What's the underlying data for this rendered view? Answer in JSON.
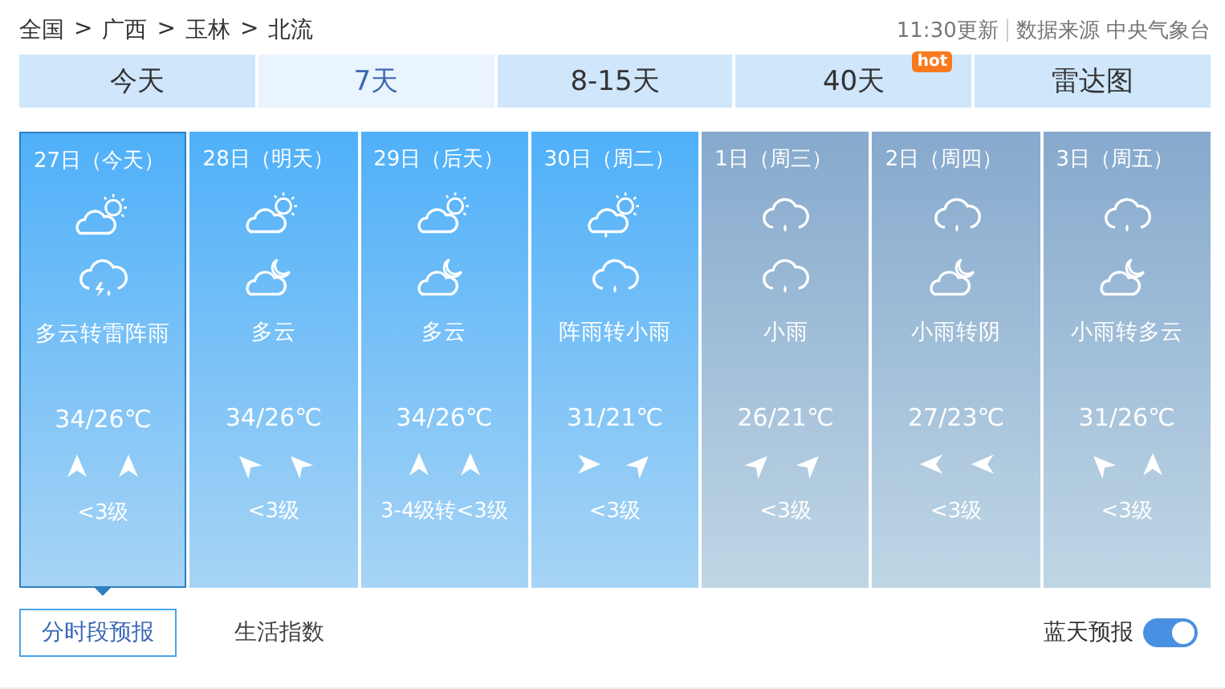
{
  "breadcrumb": [
    "全国",
    "广西",
    "玉林",
    "北流"
  ],
  "breadcrumb_separator": ">",
  "update_time": "11:30更新",
  "source": "数据来源 中央气象台",
  "tabs": [
    {
      "label": "今天",
      "selected": false,
      "hot": false
    },
    {
      "label": "7天",
      "selected": true,
      "hot": false
    },
    {
      "label": "8-15天",
      "selected": false,
      "hot": false
    },
    {
      "label": "40天",
      "selected": false,
      "hot": true
    },
    {
      "label": "雷达图",
      "selected": false,
      "hot": false
    }
  ],
  "hot_badge": "hot",
  "days": [
    {
      "date": "27日（今天）",
      "selected": true,
      "dimmed": false,
      "icons": [
        {
          "kind": "cloud-sun"
        },
        {
          "kind": "thunder-rain"
        }
      ],
      "weather": "多云转雷阵雨",
      "temp": "34/26℃",
      "winds": [
        {
          "kind": "N"
        },
        {
          "kind": "N"
        }
      ],
      "wind_level": "<3级"
    },
    {
      "date": "28日（明天）",
      "selected": false,
      "dimmed": false,
      "icons": [
        {
          "kind": "cloud-sun"
        },
        {
          "kind": "cloud-moon"
        }
      ],
      "weather": "多云",
      "temp": "34/26℃",
      "winds": [
        {
          "kind": "NW"
        },
        {
          "kind": "NW"
        }
      ],
      "wind_level": "<3级"
    },
    {
      "date": "29日（后天）",
      "selected": false,
      "dimmed": false,
      "icons": [
        {
          "kind": "cloud-sun"
        },
        {
          "kind": "cloud-moon"
        }
      ],
      "weather": "多云",
      "temp": "34/26℃",
      "winds": [
        {
          "kind": "N"
        },
        {
          "kind": "N"
        }
      ],
      "wind_level": "3-4级转<3级"
    },
    {
      "date": "30日（周二）",
      "selected": false,
      "dimmed": false,
      "icons": [
        {
          "kind": "rain-sun"
        },
        {
          "kind": "rain"
        }
      ],
      "weather": "阵雨转小雨",
      "temp": "31/21℃",
      "winds": [
        {
          "kind": "E"
        },
        {
          "kind": "NE"
        }
      ],
      "wind_level": "<3级"
    },
    {
      "date": "1日（周三）",
      "selected": false,
      "dimmed": true,
      "icons": [
        {
          "kind": "rain"
        },
        {
          "kind": "rain"
        }
      ],
      "weather": "小雨",
      "temp": "26/21℃",
      "winds": [
        {
          "kind": "NE"
        },
        {
          "kind": "NE"
        }
      ],
      "wind_level": "<3级"
    },
    {
      "date": "2日（周四）",
      "selected": false,
      "dimmed": true,
      "icons": [
        {
          "kind": "rain"
        },
        {
          "kind": "cloud-moon"
        }
      ],
      "weather": "小雨转阴",
      "temp": "27/23℃",
      "winds": [
        {
          "kind": "W"
        },
        {
          "kind": "W"
        }
      ],
      "wind_level": "<3级"
    },
    {
      "date": "3日（周五）",
      "selected": false,
      "dimmed": true,
      "icons": [
        {
          "kind": "rain"
        },
        {
          "kind": "cloud-moon"
        }
      ],
      "weather": "小雨转多云",
      "temp": "31/26℃",
      "winds": [
        {
          "kind": "NW"
        },
        {
          "kind": "N"
        }
      ],
      "wind_level": "<3级"
    }
  ],
  "bottom_tabs": [
    {
      "label": "分时段预报",
      "selected": true
    },
    {
      "label": "生活指数",
      "selected": false
    }
  ],
  "blue_sky": {
    "label": "蓝天预报",
    "on": true
  }
}
